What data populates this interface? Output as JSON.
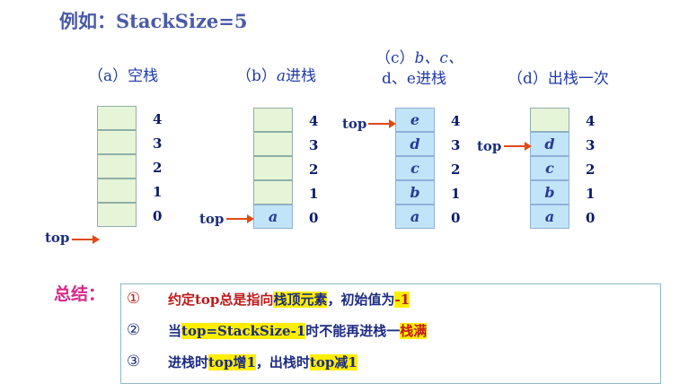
{
  "title": "例如：StackSize=5",
  "indices": [
    "4",
    "3",
    "2",
    "1",
    "0"
  ],
  "top_label": "top",
  "stacks": [
    {
      "caption_pre": "（a）",
      "caption_italic": "",
      "caption_post": "空栈",
      "caption2": "",
      "cells": [
        "",
        "",
        "",
        "",
        ""
      ]
    },
    {
      "caption_pre": "（b）",
      "caption_italic": "a",
      "caption_post": "进栈",
      "caption2": "",
      "cells": [
        "",
        "",
        "",
        "",
        "a"
      ]
    },
    {
      "caption_pre": "（c）",
      "caption_italic": "b、c、",
      "caption_post": "",
      "caption2": "d、e进栈",
      "cells": [
        "e",
        "d",
        "c",
        "b",
        "a"
      ]
    },
    {
      "caption_pre": "（d）",
      "caption_italic": "",
      "caption_post": "出栈一次",
      "caption2": "",
      "cells": [
        "",
        "d",
        "c",
        "b",
        "a"
      ]
    }
  ],
  "summary": {
    "label": "总结：",
    "items": [
      {
        "num": "①",
        "parts": [
          "约定top总是指向",
          "栈顶元素",
          "，初始值为",
          "-1"
        ]
      },
      {
        "num": "②",
        "parts": [
          "当",
          "top=StackSize-1",
          "时不能再进栈一",
          "栈满"
        ]
      },
      {
        "num": "③",
        "parts": [
          "进栈时",
          "top增1",
          "，出栈时",
          "top减1"
        ]
      }
    ]
  }
}
